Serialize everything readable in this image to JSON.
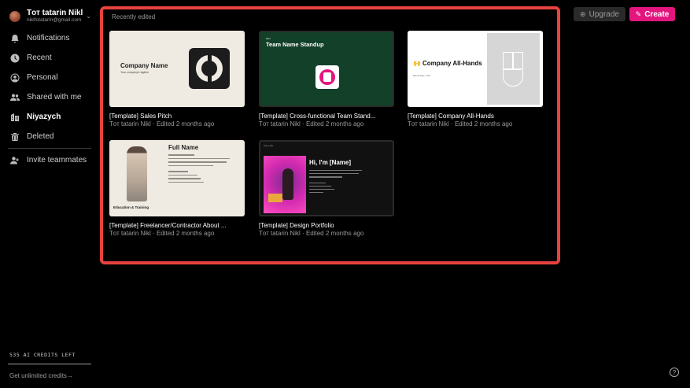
{
  "user": {
    "name": "Tот tatarin Nikl",
    "email": "niklfotatarin@gmail.com"
  },
  "nav": [
    {
      "label": "Notifications",
      "icon": "bell-icon"
    },
    {
      "label": "Recent",
      "icon": "clock-icon"
    },
    {
      "label": "Personal",
      "icon": "user-circle-icon"
    },
    {
      "label": "Shared with me",
      "icon": "users-icon"
    },
    {
      "label": "Niyazych",
      "icon": "building-icon"
    },
    {
      "label": "Deleted",
      "icon": "trash-icon"
    }
  ],
  "invite_label": "Invite teammates",
  "credits_label": "535 AI CREDITS LEFT",
  "unlimited_label": "Get unlimited credits→",
  "toolbar": {
    "upgrade_label": "Upgrade",
    "create_label": "Create"
  },
  "section_label": "Recently edited",
  "cards": [
    {
      "title": "[Template] Sales Pitch",
      "meta": "Tот tatarin Nikl · Edited 2 months ago",
      "thumb_heading": "Company Name",
      "thumb_sub": "Your company's tagline"
    },
    {
      "title": "[Template] Cross-functional Team Stand...",
      "meta": "Tот tatarin Nikl · Edited 2 months ago",
      "thumb_small": "Mon",
      "thumb_heading": "Team Name Standup"
    },
    {
      "title": "[Template] Company All-Hands",
      "meta": "Tот tatarin Nikl · Edited 2 months ago",
      "thumb_emoji": "🙌",
      "thumb_heading": "Company All-Hands",
      "thumb_sub": "Month Day, Year"
    },
    {
      "title": "[Template] Freelancer/Contractor About ...",
      "meta": "Tот tatarin Nikl · Edited 2 months ago",
      "thumb_heading": "Full Name",
      "thumb_sub": "Education & Training"
    },
    {
      "title": "[Template] Design Portfolio",
      "meta": "Tот tatarin Nikl · Edited 2 months ago",
      "thumb_small": "Name Bio",
      "thumb_heading": "Hi, I'm [Name]"
    }
  ]
}
